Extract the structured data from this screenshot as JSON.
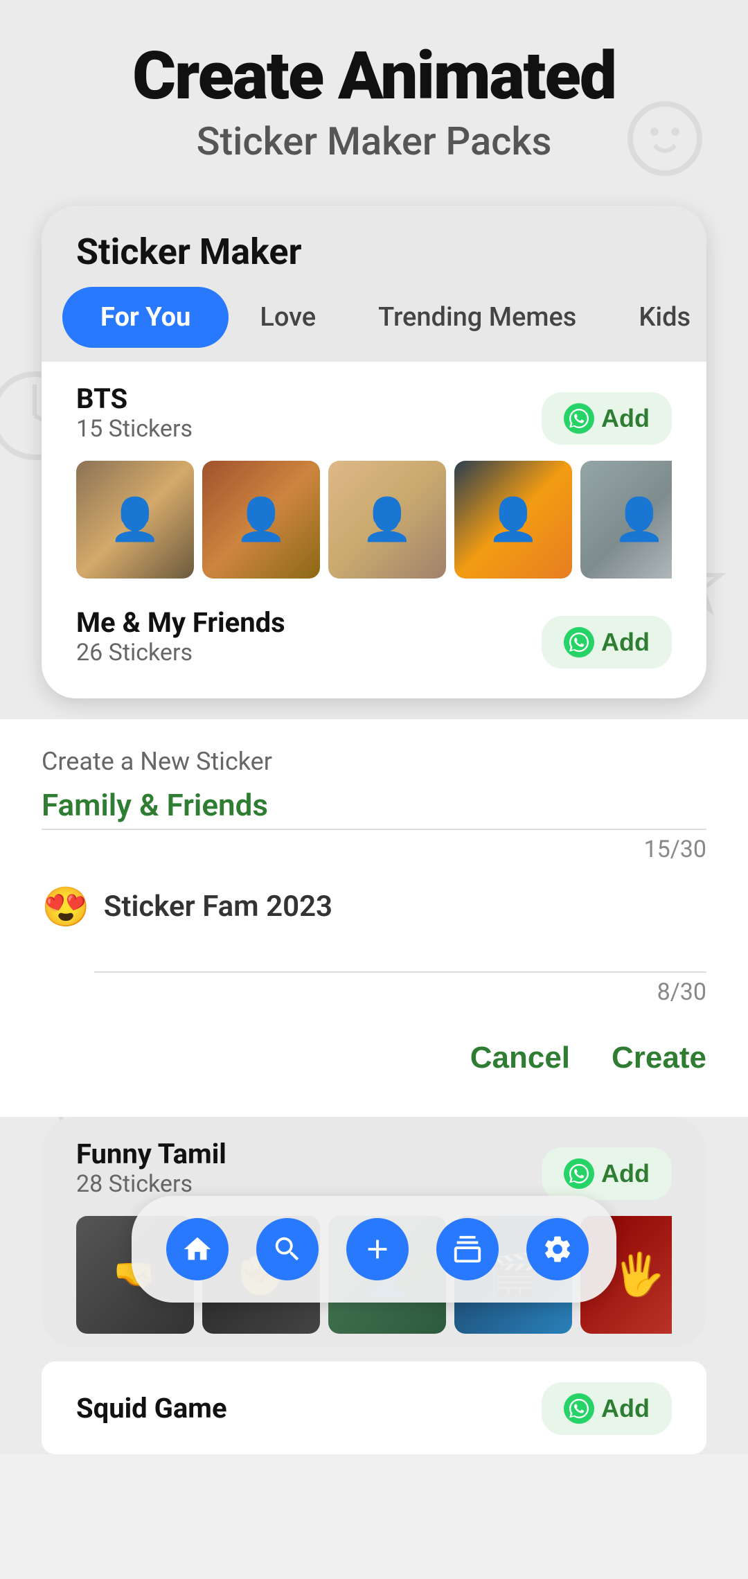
{
  "header": {
    "main_title": "Create Animated",
    "sub_title": "Sticker Maker Packs"
  },
  "phone_card": {
    "title": "Sticker Maker",
    "tabs": [
      {
        "label": "For You",
        "active": true
      },
      {
        "label": "Love",
        "active": false
      },
      {
        "label": "Trending Memes",
        "active": false
      },
      {
        "label": "Kids",
        "active": false
      }
    ]
  },
  "sticker_packs": [
    {
      "name": "BTS",
      "count": "15 Stickers",
      "add_label": "Add",
      "thumbs": [
        "thumb-1",
        "thumb-2",
        "thumb-3",
        "thumb-4",
        "thumb-5"
      ]
    },
    {
      "name": "Me & My Friends",
      "count": "26 Stickers",
      "add_label": "Add"
    },
    {
      "name": "Funny Tamil",
      "count": "28 Stickers",
      "add_label": "Add",
      "thumbs": [
        "thumb-ft1",
        "thumb-ft2",
        "thumb-ft3",
        "thumb-ft4",
        "thumb-ft5"
      ]
    },
    {
      "name": "Squid Game",
      "count": "",
      "add_label": "Add"
    }
  ],
  "dialog": {
    "label": "Create a New Sticker",
    "pack_name_placeholder": "Family & Friends",
    "pack_counter": "15/30",
    "pack_emoji": "😍",
    "pack_name_2": "Sticker Fam 2023",
    "pack_counter_2": "8/30",
    "cancel_label": "Cancel",
    "create_label": "Create"
  },
  "bottom_nav": {
    "items": [
      {
        "icon": "home",
        "label": "home"
      },
      {
        "icon": "search",
        "label": "search"
      },
      {
        "icon": "add",
        "label": "add"
      },
      {
        "icon": "collection",
        "label": "collection"
      },
      {
        "icon": "settings",
        "label": "settings"
      }
    ]
  }
}
